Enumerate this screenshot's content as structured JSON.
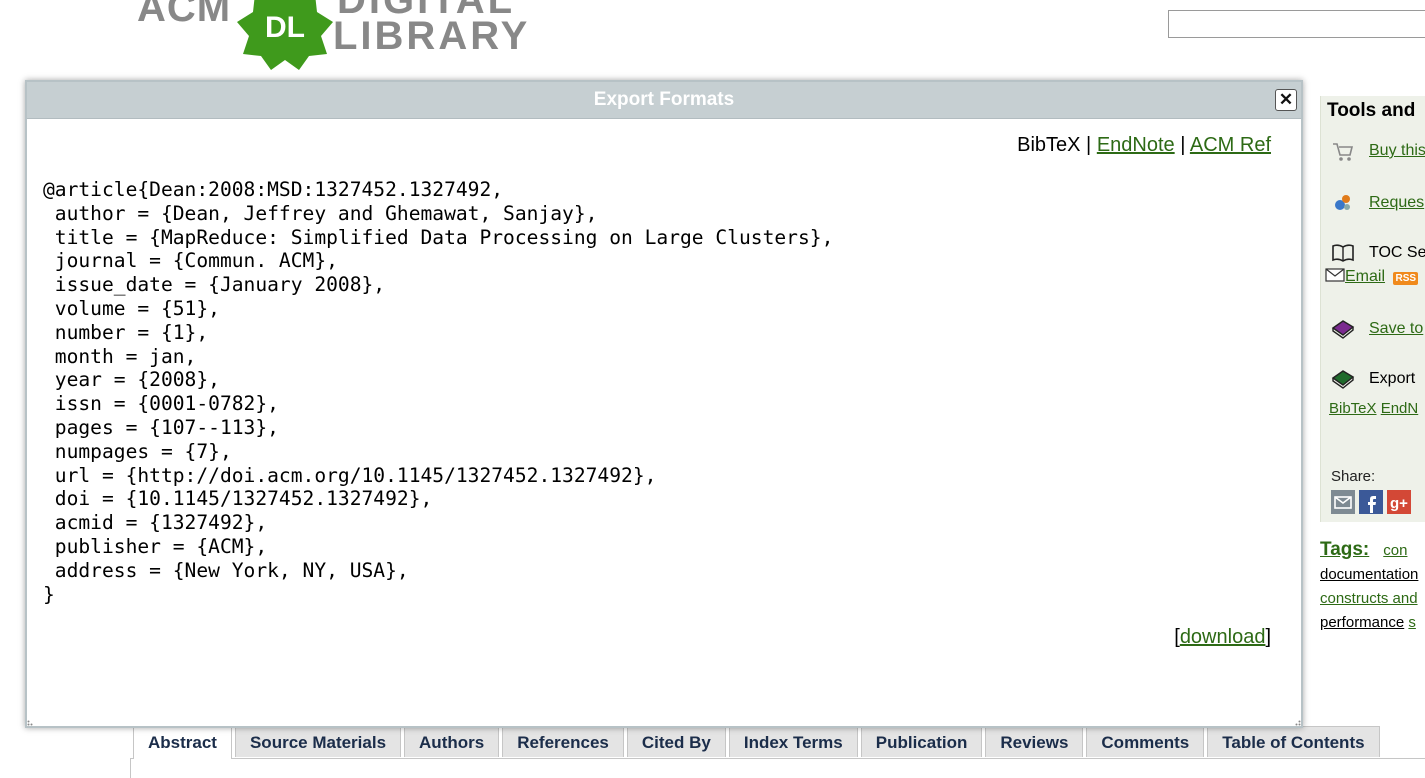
{
  "header": {
    "logo": {
      "acm": "ACM",
      "badge": "DL",
      "digital": "DIGITAL",
      "library": "LIBRARY"
    },
    "search": {
      "value": "",
      "placeholder": ""
    }
  },
  "modal": {
    "title": "Export Formats",
    "close_label": "✕",
    "formats": {
      "active": "BibTeX",
      "separator": "|",
      "endnote": "EndNote",
      "acm_ref": "ACM Ref"
    },
    "bibtex": "@article{Dean:2008:MSD:1327452.1327492,\n author = {Dean, Jeffrey and Ghemawat, Sanjay},\n title = {MapReduce: Simplified Data Processing on Large Clusters},\n journal = {Commun. ACM},\n issue_date = {January 2008},\n volume = {51},\n number = {1},\n month = jan,\n year = {2008},\n issn = {0001-0782},\n pages = {107--113},\n numpages = {7},\n url = {http://doi.acm.org/10.1145/1327452.1327492},\n doi = {10.1145/1327452.1327492},\n acmid = {1327492},\n publisher = {ACM},\n address = {New York, NY, USA},\n}",
    "download": {
      "open": "[",
      "label": "download",
      "close": "]"
    }
  },
  "sidebar": {
    "title": "Tools and",
    "buy": "Buy this",
    "request": "Reques",
    "toc": "TOC Se",
    "email": "Email",
    "rss": "RSS",
    "save": "Save to",
    "export": "Export",
    "bibtex": "BibTeX",
    "endnote": "EndN",
    "share_label": "Share:"
  },
  "tags": {
    "label": "Tags:",
    "t1": "con",
    "t2": "documentation",
    "t3": "constructs and",
    "t4": "performance",
    "t5": "s"
  },
  "tabs": [
    "Abstract",
    "Source Materials",
    "Authors",
    "References",
    "Cited By",
    "Index Terms",
    "Publication",
    "Reviews",
    "Comments",
    "Table of Contents"
  ],
  "colors": {
    "link": "#2d6a15",
    "titlebar": "#c6cfd2",
    "tab_bg": "#e4e4e4",
    "dl_badge": "#3f9a1c"
  }
}
